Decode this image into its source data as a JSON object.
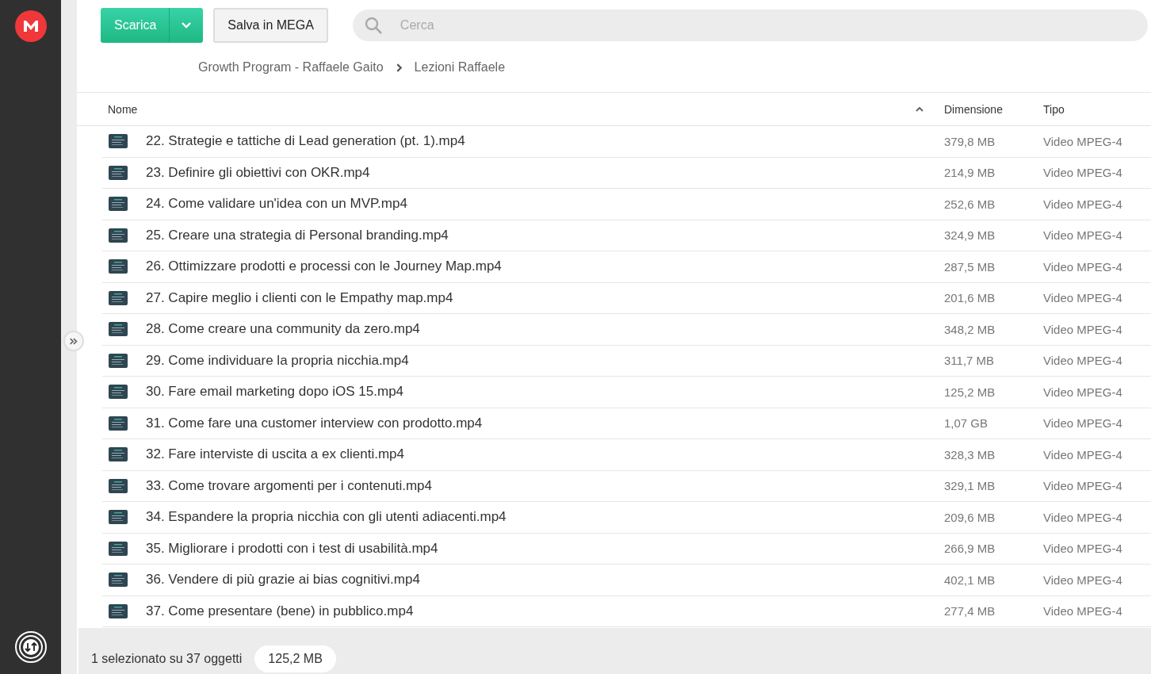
{
  "toolbar": {
    "download_button": "Scarica",
    "save_button": "Salva in MEGA",
    "search": {
      "placeholder": "Cerca"
    }
  },
  "breadcrumb": [
    "Growth Program - Raffaele Gaito",
    "Lezioni Raffaele"
  ],
  "table": {
    "columns": [
      "Nome",
      "Dimensione",
      "Tipo"
    ],
    "rows": [
      {
        "name": "22. Strategie e tattiche di Lead generation (pt. 1).mp4",
        "size": "379,8 MB",
        "type": "Video MPEG-4"
      },
      {
        "name": "23. Definire gli obiettivi con OKR.mp4",
        "size": "214,9 MB",
        "type": "Video MPEG-4"
      },
      {
        "name": "24. Come validare un'idea con un MVP.mp4",
        "size": "252,6 MB",
        "type": "Video MPEG-4"
      },
      {
        "name": "25. Creare una strategia di Personal branding.mp4",
        "size": "324,9 MB",
        "type": "Video MPEG-4"
      },
      {
        "name": "26. Ottimizzare prodotti e processi con le Journey Map.mp4",
        "size": "287,5 MB",
        "type": "Video MPEG-4"
      },
      {
        "name": "27. Capire meglio i clienti con le Empathy map.mp4",
        "size": "201,6 MB",
        "type": "Video MPEG-4"
      },
      {
        "name": "28. Come creare una community da zero.mp4",
        "size": "348,2 MB",
        "type": "Video MPEG-4"
      },
      {
        "name": "29. Come individuare la propria nicchia.mp4",
        "size": "311,7 MB",
        "type": "Video MPEG-4"
      },
      {
        "name": "30. Fare email marketing dopo iOS 15.mp4",
        "size": "125,2 MB",
        "type": "Video MPEG-4"
      },
      {
        "name": "31. Come fare una customer interview con prodotto.mp4",
        "size": "1,07 GB",
        "type": "Video MPEG-4"
      },
      {
        "name": "32. Fare interviste di uscita a ex clienti.mp4",
        "size": "328,3 MB",
        "type": "Video MPEG-4"
      },
      {
        "name": "33. Come trovare argomenti per i contenuti.mp4",
        "size": "329,1 MB",
        "type": "Video MPEG-4"
      },
      {
        "name": "34. Espandere la propria nicchia con gli utenti adiacenti.mp4",
        "size": "209,6 MB",
        "type": "Video MPEG-4"
      },
      {
        "name": "35. Migliorare i prodotti con i test di usabilità.mp4",
        "size": "266,9 MB",
        "type": "Video MPEG-4"
      },
      {
        "name": "36. Vendere di più grazie ai bias cognitivi.mp4",
        "size": "402,1 MB",
        "type": "Video MPEG-4"
      },
      {
        "name": "37. Come presentare (bene) in pubblico.mp4",
        "size": "277,4 MB",
        "type": "Video MPEG-4"
      }
    ]
  },
  "status_bar": {
    "selection": "1 selezionato su 37 oggetti",
    "selected_size": "125,2 MB"
  }
}
